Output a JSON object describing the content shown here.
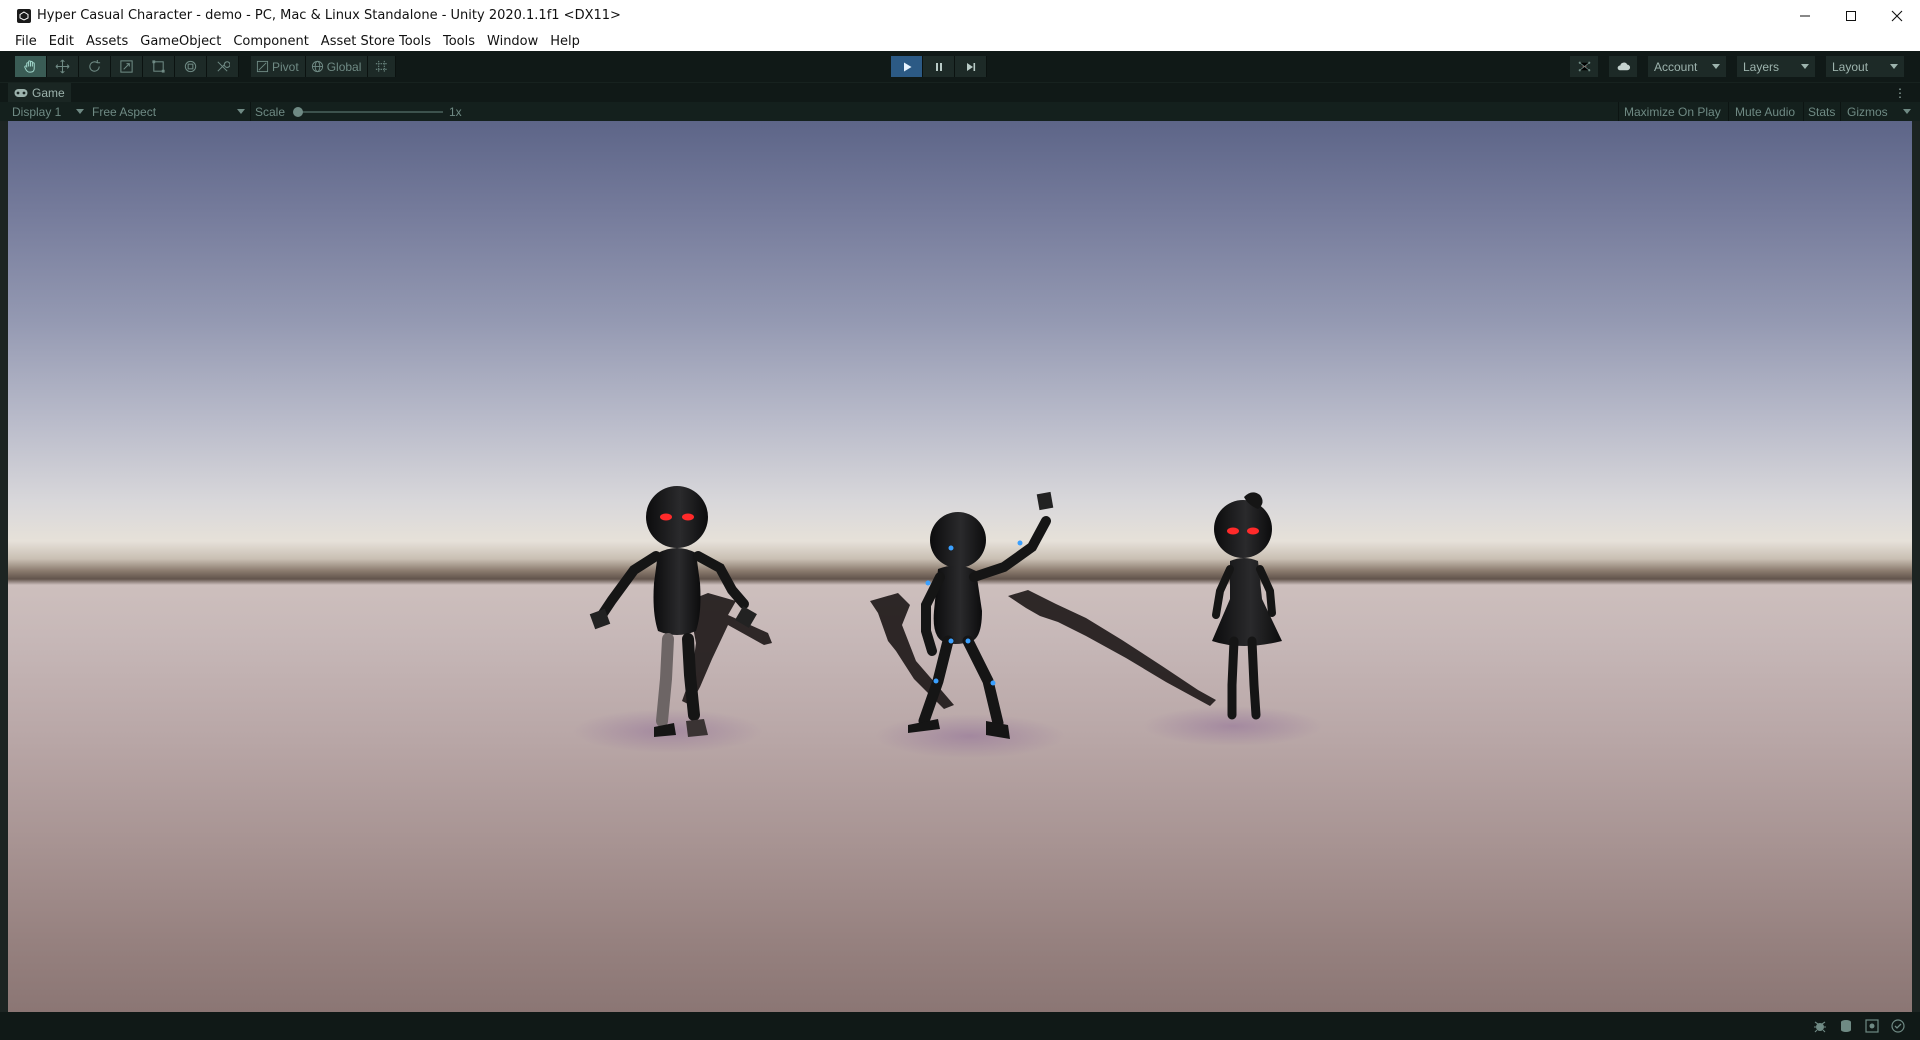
{
  "window": {
    "title": "Hyper Casual Character - demo - PC, Mac & Linux Standalone - Unity 2020.1.1f1 <DX11>"
  },
  "menu": [
    "File",
    "Edit",
    "Assets",
    "GameObject",
    "Component",
    "Asset Store Tools",
    "Tools",
    "Window",
    "Help"
  ],
  "toolbar": {
    "tools": [
      "hand-tool-icon",
      "move-tool-icon",
      "rotate-tool-icon",
      "scale-tool-icon",
      "rect-tool-icon",
      "transform-tool-icon",
      "custom-tool-icon"
    ],
    "active_tool": "hand-tool-icon",
    "pivot_label": "Pivot",
    "global_label": "Global",
    "play_state": "playing",
    "account_label": "Account",
    "layers_label": "Layers",
    "layout_label": "Layout"
  },
  "game_view": {
    "tab_label": "Game",
    "display": "Display 1",
    "aspect": "Free Aspect",
    "scale_label": "Scale",
    "scale_value": "1x",
    "maximize_on_play": "Maximize On Play",
    "mute_audio": "Mute Audio",
    "stats": "Stats",
    "gizmos": "Gizmos"
  },
  "colors": {
    "accent_play": "#2c5a85",
    "toolbar_bg": "#101917",
    "eye_glow": "#ff2a2a",
    "joint_glow": "#3aa0ff"
  }
}
